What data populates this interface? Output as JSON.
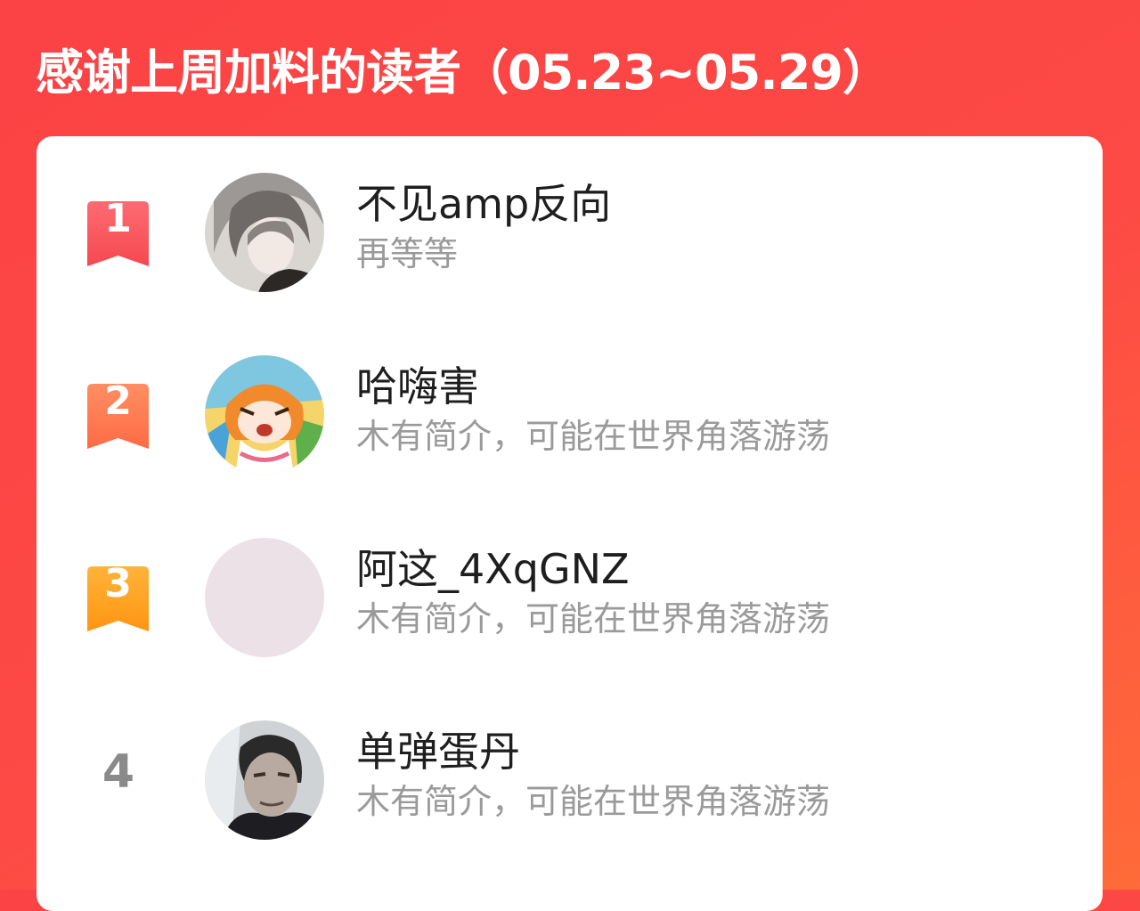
{
  "header": {
    "title": "感谢上周加料的读者（05.23~05.29）"
  },
  "colors": {
    "background_top": "#fb4245",
    "background_bottom": "#ff6b39",
    "rank_1": "#f9555e",
    "rank_2": "#ff7a50",
    "rank_3": "#ffa01e",
    "rank_plain": "#8a8a8a",
    "name_text": "#1e1e1e",
    "bio_text": "#9a9a9a"
  },
  "readers": [
    {
      "rank": "1",
      "name": "不见amp反向",
      "bio": "再等等",
      "avatar": "anime-girl-gray-hair-avatar"
    },
    {
      "rank": "2",
      "name": "哈嗨害",
      "bio": "木有简介，可能在世界角落游荡",
      "avatar": "anime-umaru-avatar"
    },
    {
      "rank": "3",
      "name": "阿这_4XqGNZ",
      "bio": "木有简介，可能在世界角落游荡",
      "avatar": "blank-pink-avatar"
    },
    {
      "rank": "4",
      "name": "单弹蛋丹",
      "bio": "木有简介，可能在世界角落游荡",
      "avatar": "man-photo-avatar"
    }
  ]
}
